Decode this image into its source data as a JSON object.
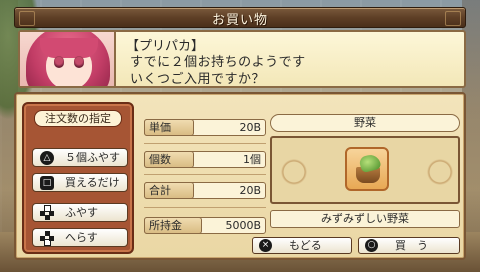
{
  "title": "お買い物",
  "dialogue": {
    "speaker": "【プリパカ】",
    "line1": "すでに２個お持ちのようです",
    "line2": "いくつご入用ですか？"
  },
  "order": {
    "heading": "注文数の指定",
    "commands": [
      {
        "label": "５個ふやす",
        "button": "△"
      },
      {
        "label": "買えるだけ",
        "button": "□"
      },
      {
        "label": "ふやす",
        "button": "dpad-up"
      },
      {
        "label": "へらす",
        "button": "dpad-down"
      }
    ]
  },
  "stats": {
    "unit_price": {
      "label": "単価",
      "value": "20B"
    },
    "quantity": {
      "label": "個数",
      "value": "1個"
    },
    "total": {
      "label": "合計",
      "value": "20B"
    },
    "money": {
      "label": "所持金",
      "value": "5000B"
    }
  },
  "item": {
    "category": "野菜",
    "name": "みずみずしい野菜",
    "icon": "vegetable-basket-icon"
  },
  "buttons": {
    "back": {
      "label": "もどる",
      "button": "×"
    },
    "buy": {
      "label": "買　う",
      "button": "○"
    }
  }
}
